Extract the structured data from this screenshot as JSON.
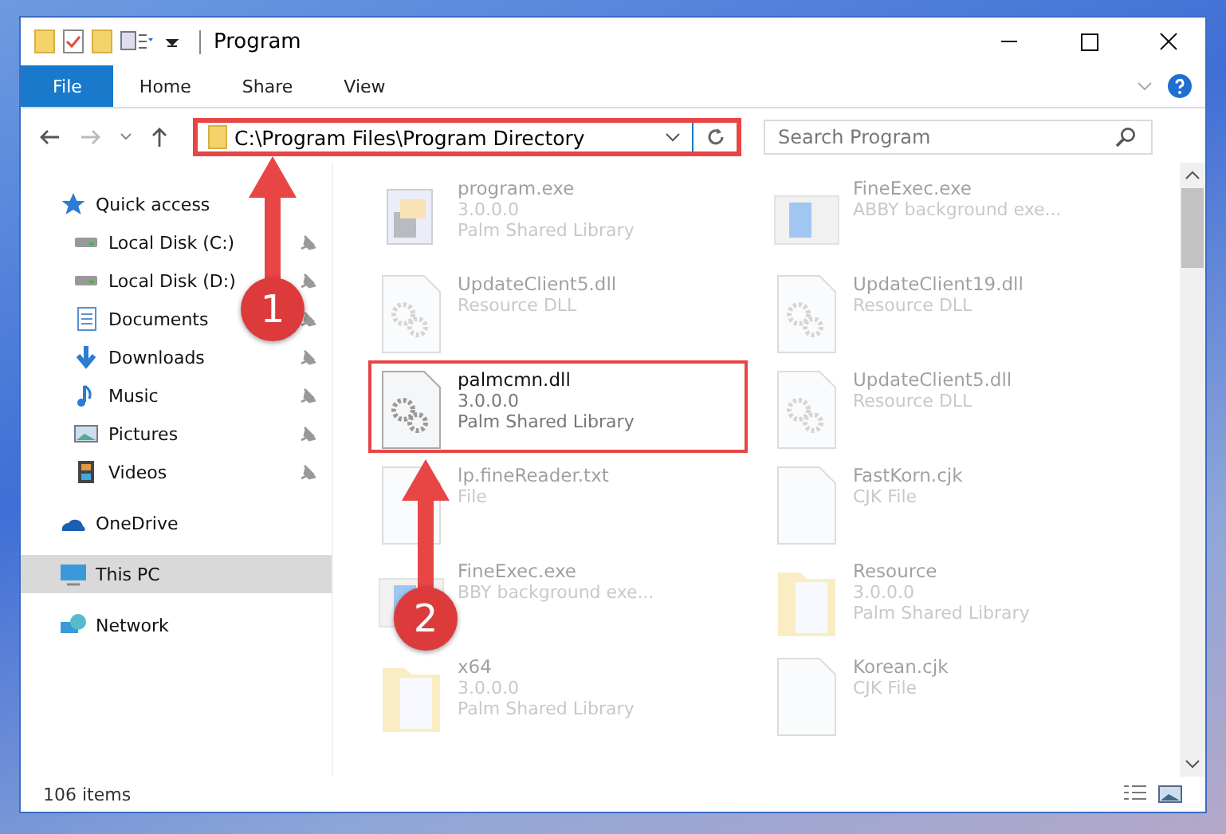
{
  "window": {
    "title": "Program"
  },
  "ribbon_tabs": [
    {
      "label": "File",
      "selected": true
    },
    {
      "label": "Home",
      "selected": false
    },
    {
      "label": "Share",
      "selected": false
    },
    {
      "label": "View",
      "selected": false
    }
  ],
  "address": {
    "path": "C:\\Program Files\\Program Directory",
    "highlighted": true
  },
  "search": {
    "placeholder": "Search Program"
  },
  "nav": [
    {
      "label": "Quick access",
      "kind": "star",
      "selected": false,
      "children": [
        {
          "label": "Local Disk (C:)",
          "kind": "disk",
          "pinned": true,
          "selected": false
        },
        {
          "label": "Local Disk (D:)",
          "kind": "disk",
          "pinned": true,
          "selected": false
        },
        {
          "label": "Documents",
          "kind": "doc",
          "pinned": true,
          "selected": false
        },
        {
          "label": "Downloads",
          "kind": "down",
          "pinned": true,
          "selected": false
        },
        {
          "label": "Music",
          "kind": "music",
          "pinned": true,
          "selected": false
        },
        {
          "label": "Pictures",
          "kind": "pics",
          "pinned": true,
          "selected": false
        },
        {
          "label": "Videos",
          "kind": "video",
          "pinned": true,
          "selected": false
        }
      ]
    },
    {
      "label": "OneDrive",
      "kind": "cloud",
      "selected": false
    },
    {
      "label": "This PC",
      "kind": "pc",
      "selected": true
    },
    {
      "label": "Network",
      "kind": "net",
      "selected": false
    }
  ],
  "files": [
    {
      "name": "program.exe",
      "lines": [
        "3.0.0.0",
        "Palm Shared Library"
      ],
      "kind": "exe",
      "faded": true,
      "highlighted": false
    },
    {
      "name": "FineExec.exe",
      "lines": [
        "ABBY background exe..."
      ],
      "kind": "app",
      "faded": true,
      "highlighted": false
    },
    {
      "name": "UpdateClient5.dll",
      "lines": [
        "Resource DLL"
      ],
      "kind": "dll",
      "faded": true,
      "highlighted": false
    },
    {
      "name": "UpdateClient19.dll",
      "lines": [
        "Resource DLL"
      ],
      "kind": "dll",
      "faded": true,
      "highlighted": false
    },
    {
      "name": "palmcmn.dll",
      "lines": [
        "3.0.0.0",
        "Palm Shared Library"
      ],
      "kind": "dll",
      "faded": false,
      "highlighted": true
    },
    {
      "name": "UpdateClient5.dll",
      "lines": [
        "Resource DLL"
      ],
      "kind": "dll",
      "faded": true,
      "highlighted": false
    },
    {
      "name": "lp.fineReader.txt",
      "lines": [
        "File"
      ],
      "kind": "doc",
      "faded": true,
      "highlighted": false
    },
    {
      "name": "FastKorn.cjk",
      "lines": [
        "CJK File"
      ],
      "kind": "doc",
      "faded": true,
      "highlighted": false
    },
    {
      "name": "FineExec.exe",
      "lines": [
        "BBY background exe..."
      ],
      "kind": "app",
      "faded": true,
      "highlighted": false
    },
    {
      "name": "Resource",
      "lines": [
        "3.0.0.0",
        "Palm Shared Library"
      ],
      "kind": "folder",
      "faded": true,
      "highlighted": false
    },
    {
      "name": "x64",
      "lines": [
        "3.0.0.0",
        "Palm Shared Library"
      ],
      "kind": "folder",
      "faded": true,
      "highlighted": false
    },
    {
      "name": "Korean.cjk",
      "lines": [
        "CJK File"
      ],
      "kind": "doc",
      "faded": true,
      "highlighted": false
    }
  ],
  "status_bar": {
    "count": "106 items"
  },
  "annotations": [
    {
      "label": "1"
    },
    {
      "label": "2"
    }
  ]
}
